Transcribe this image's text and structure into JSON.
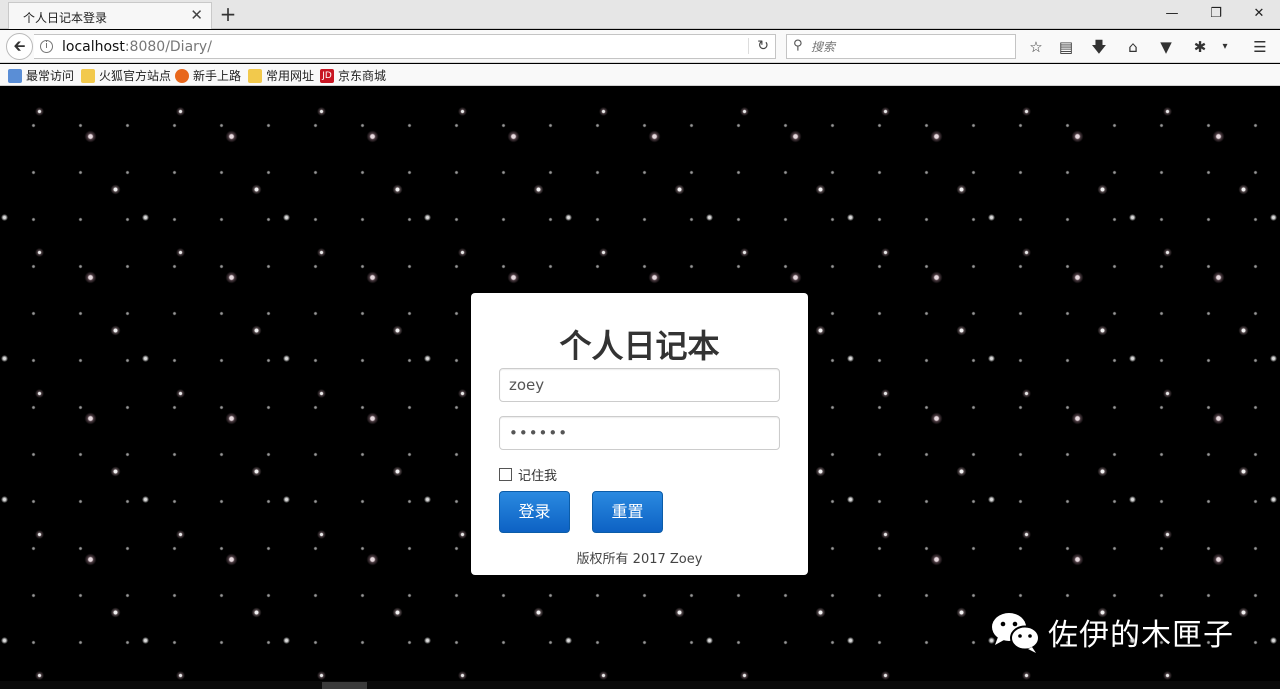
{
  "browser": {
    "tab_title": "个人日记本登录",
    "tab_close": "✕",
    "new_tab": "+",
    "url_host": "localhost",
    "url_path": ":8080/Diary/",
    "search_placeholder": "搜索",
    "bookmarks": [
      {
        "label": "最常访问",
        "icon": "most-visited-icon",
        "color": "#5a8ed6"
      },
      {
        "label": "火狐官方站点",
        "icon": "folder-icon",
        "color": "#f2c94c"
      },
      {
        "label": "新手上路",
        "icon": "firefox-icon",
        "color": "#e8671c"
      },
      {
        "label": "常用网址",
        "icon": "folder-icon",
        "color": "#f2c94c"
      },
      {
        "label": "京东商城",
        "icon": "jd-icon",
        "color": "#c81623"
      }
    ],
    "jd_badge": "JD"
  },
  "login": {
    "title": "个人日记本",
    "username_value": "zoey",
    "password_value": "••••••",
    "remember_label": "记住我",
    "login_button": "登录",
    "reset_button": "重置",
    "footer": "版权所有 2017 Zoey",
    "button_color": "#0d62c4"
  },
  "watermark": {
    "text": "佐伊的木匣子",
    "icon": "wechat-icon"
  }
}
